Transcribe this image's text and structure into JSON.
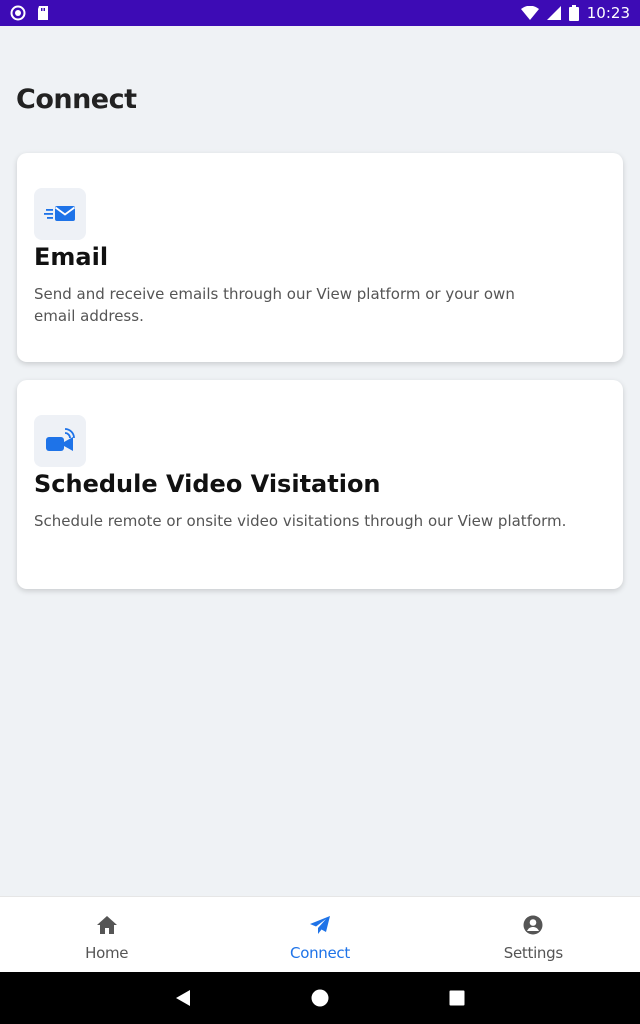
{
  "status_bar": {
    "time": "10:23",
    "icons": [
      "circle-notification-icon",
      "sd-card-icon",
      "wifi-icon",
      "cell-signal-icon",
      "battery-icon"
    ]
  },
  "page": {
    "title": "Connect"
  },
  "cards": [
    {
      "icon": "email-icon",
      "title": "Email",
      "description": "Send and receive emails through our View platform or your own email address."
    },
    {
      "icon": "video-camera-icon",
      "title": "Schedule Video Visitation",
      "description": "Schedule remote or onsite video visitations through our View platform."
    }
  ],
  "bottom_nav": {
    "items": [
      {
        "label": "Home",
        "icon": "home-icon",
        "active": false
      },
      {
        "label": "Connect",
        "icon": "paper-plane-icon",
        "active": true
      },
      {
        "label": "Settings",
        "icon": "account-circle-icon",
        "active": false
      }
    ]
  },
  "system_nav": {
    "buttons": [
      "back-icon",
      "home-circle-icon",
      "recents-icon"
    ]
  },
  "colors": {
    "status_bar": "#3d0bb5",
    "accent": "#1e73e8",
    "background": "#eff2f5"
  }
}
